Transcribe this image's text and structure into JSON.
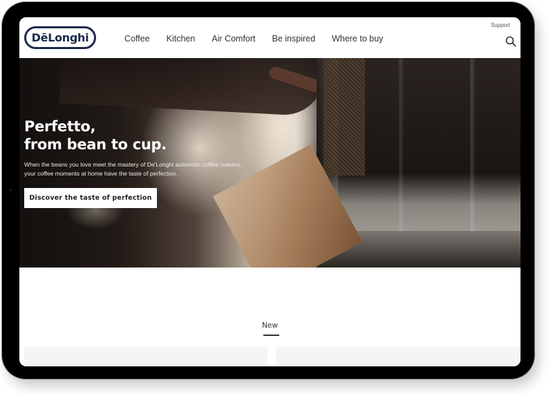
{
  "brand": {
    "logo_text": "DēLonghi",
    "logo_color": "#1b2a4a"
  },
  "header": {
    "nav": [
      {
        "label": "Coffee"
      },
      {
        "label": "Kitchen"
      },
      {
        "label": "Air Comfort"
      },
      {
        "label": "Be inspired"
      },
      {
        "label": "Where to buy"
      }
    ],
    "support_label": "Support",
    "search_icon": "search-icon"
  },
  "hero": {
    "title_line1": "Perfetto,",
    "title_line2": "from bean to cup.",
    "text_line1": "When the beans you love meet the mastery of De'Longhi automatic coffee makers,",
    "text_line2": "your coffee moments at home have the taste of perfection.",
    "cta_label": "Discover the taste of perfection"
  },
  "sections": {
    "new_label": "New"
  }
}
